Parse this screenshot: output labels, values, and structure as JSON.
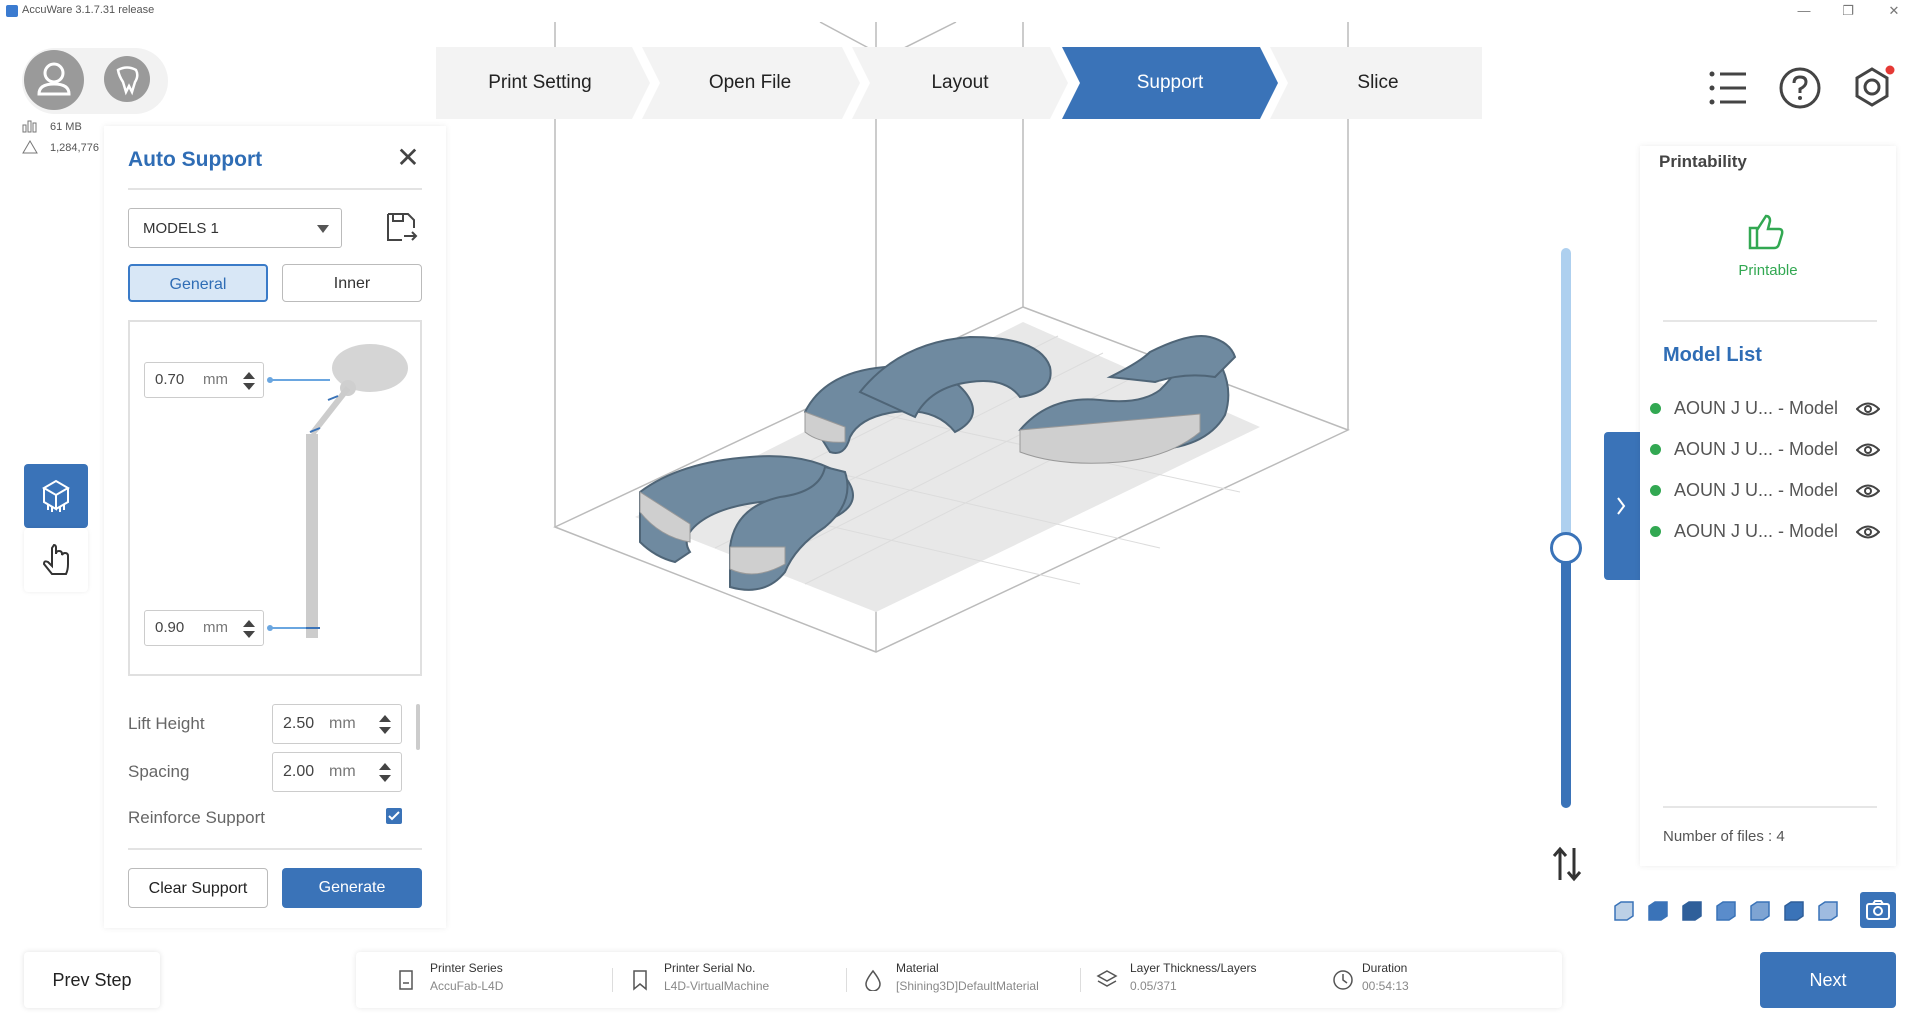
{
  "window": {
    "title": "AccuWare 3.1.7.31 release",
    "minimize_icon": "minimize-icon",
    "restore_icon": "restore-icon",
    "close_icon": "close-icon"
  },
  "stats": {
    "memory": "61 MB",
    "triangles": "1,284,776"
  },
  "steps": [
    {
      "label": "Print Setting",
      "active": false
    },
    {
      "label": "Open File",
      "active": false
    },
    {
      "label": "Layout",
      "active": false
    },
    {
      "label": "Support",
      "active": true
    },
    {
      "label": "Slice",
      "active": false
    }
  ],
  "auto_support": {
    "title": "Auto Support",
    "model_select": "MODELS 1",
    "tabs": {
      "general": "General",
      "inner": "Inner"
    },
    "tip_diameter": {
      "value": "0.70",
      "unit": "mm"
    },
    "base_diameter": {
      "value": "0.90",
      "unit": "mm"
    },
    "lift_height": {
      "label": "Lift Height",
      "value": "2.50",
      "unit": "mm"
    },
    "spacing": {
      "label": "Spacing",
      "value": "2.00",
      "unit": "mm"
    },
    "reinforce_support": {
      "label": "Reinforce Support",
      "checked": true
    },
    "clear_button": "Clear Support",
    "generate_button": "Generate"
  },
  "right_panel": {
    "printability_title": "Printability",
    "printable_label": "Printable",
    "model_list_title": "Model List",
    "models": [
      "AOUN J U... - Model",
      "AOUN J U... - Model",
      "AOUN J U... - Model",
      "AOUN J U... - Model"
    ],
    "file_count": "Number of files : 4"
  },
  "bottom": {
    "prev_button": "Prev Step",
    "next_button": "Next",
    "info": [
      {
        "label": "Printer Series",
        "value": "AccuFab-L4D",
        "icon": "printer-icon"
      },
      {
        "label": "Printer Serial No.",
        "value": "L4D-VirtualMachine",
        "icon": "bookmark-icon"
      },
      {
        "label": "Material",
        "value": "[Shining3D]DefaultMaterial",
        "icon": "droplet-icon"
      },
      {
        "label": "Layer Thickness/Layers",
        "value": "0.05/371",
        "icon": "layers-icon"
      },
      {
        "label": "Duration",
        "value": "00:54:13",
        "icon": "clock-icon"
      }
    ]
  },
  "colors": {
    "accent": "#3a73b8",
    "title_blue": "#2f6db5",
    "status_green": "#32a852",
    "model_fill": "#6f8aa0"
  }
}
